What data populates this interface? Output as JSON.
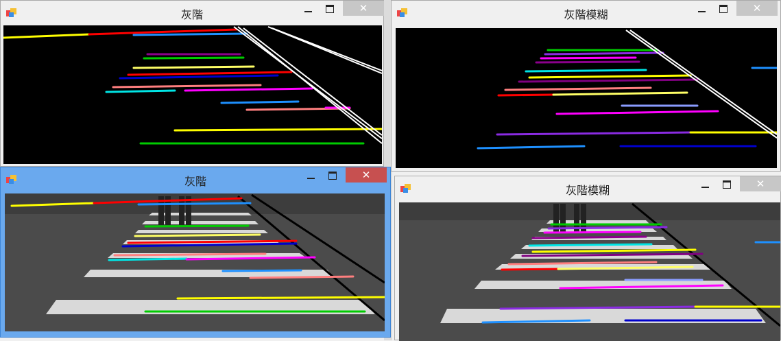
{
  "windows": {
    "top_left": {
      "title": "灰階",
      "close_glyph": "✕"
    },
    "top_right": {
      "title": "灰階模糊",
      "close_glyph": "✕"
    },
    "bottom_left": {
      "title": "灰階",
      "close_glyph": "✕"
    },
    "bottom_right": {
      "title": "灰階模糊",
      "close_glyph": "✕"
    }
  },
  "colors": {
    "active_titlebar": "#6aa9ee",
    "active_close": "#c75050",
    "inactive_close": "#c7c7c7",
    "canvas_bg": "#000000",
    "road": "#4a4a4a",
    "stripe": "#d8d8d8"
  }
}
